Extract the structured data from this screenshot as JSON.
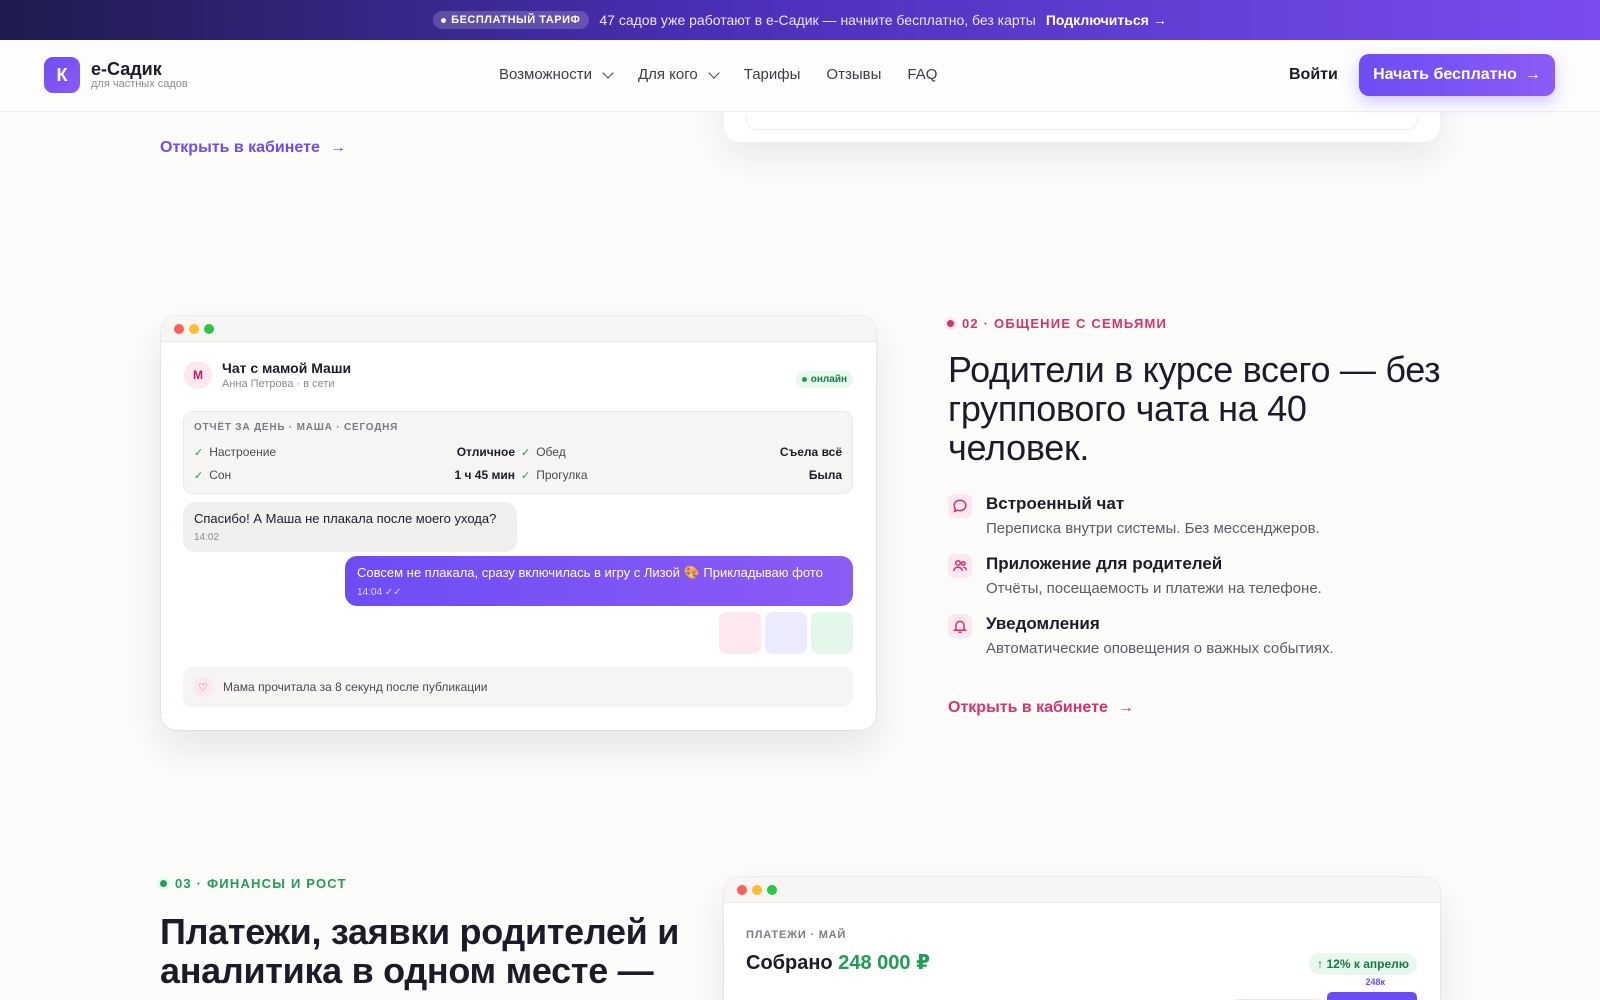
{
  "promo": {
    "badge": "БЕСПЛАТНЫЙ ТАРИФ",
    "text": "47 садов уже работают в е-Садик — начните бесплатно, без карты",
    "link": "Подключиться"
  },
  "header": {
    "logo_letter": "К",
    "brand": "е-Садик",
    "tagline": "для частных садов",
    "nav": [
      {
        "label": "Возможности",
        "dropdown": true
      },
      {
        "label": "Для кого",
        "dropdown": true
      },
      {
        "label": "Тарифы",
        "dropdown": false
      },
      {
        "label": "Отзывы",
        "dropdown": false
      },
      {
        "label": "FAQ",
        "dropdown": false
      }
    ],
    "login": "Войти",
    "cta": "Начать бесплатно"
  },
  "section1": {
    "link": "Открыть в кабинете"
  },
  "chat": {
    "avatar": "М",
    "title": "Чат с мамой Маши",
    "subtitle": "Анна Петрова · в сети",
    "status": "онлайн",
    "report_title": "ОТЧЁТ ЗА ДЕНЬ · МАША · СЕГОДНЯ",
    "report": [
      {
        "label": "Настроение",
        "value": "Отличное"
      },
      {
        "label": "Обед",
        "value": "Съела всё"
      },
      {
        "label": "Сон",
        "value": "1 ч 45 мин"
      },
      {
        "label": "Прогулка",
        "value": "Была"
      }
    ],
    "msg_in": {
      "text": "Спасибо! А Маша не плакала после моего ухода?",
      "time": "14:02"
    },
    "msg_out": {
      "text": "Совсем не плакала, сразу включилась в игру с Лизой 🎨 Прикладываю фото",
      "time": "14:04 ✓✓"
    },
    "read_note": "Мама прочитала за 8 секунд после публикации"
  },
  "section2": {
    "eyebrow": "02 · ОБЩЕНИЕ С СЕМЬЯМИ",
    "heading": "Родители в курсе всего — без группового чата на 40 человек.",
    "features": [
      {
        "icon": "chat-bubble-icon",
        "title": "Встроенный чат",
        "desc": "Переписка внутри системы. Без мессенджеров."
      },
      {
        "icon": "users-icon",
        "title": "Приложение для родителей",
        "desc": "Отчёты, посещаемость и платежи на телефоне."
      },
      {
        "icon": "bell-icon",
        "title": "Уведомления",
        "desc": "Автоматические оповещения о важных событиях."
      }
    ],
    "link": "Открыть в кабинете"
  },
  "section3": {
    "eyebrow": "03 · ФИНАНСЫ И РОСТ",
    "heading": "Платежи, заявки родителей и аналитика в одном месте —",
    "card": {
      "eyebrow": "ПЛАТЕЖИ · МАЙ",
      "total_label": "Собрано",
      "total_value": "248 000 ₽",
      "growth": "↑ 12% к апрелю",
      "bar_label": "248к"
    }
  },
  "colors": {
    "accent": "#6e4cf5",
    "pink": "#d6336c",
    "green": "#1f9d55"
  }
}
